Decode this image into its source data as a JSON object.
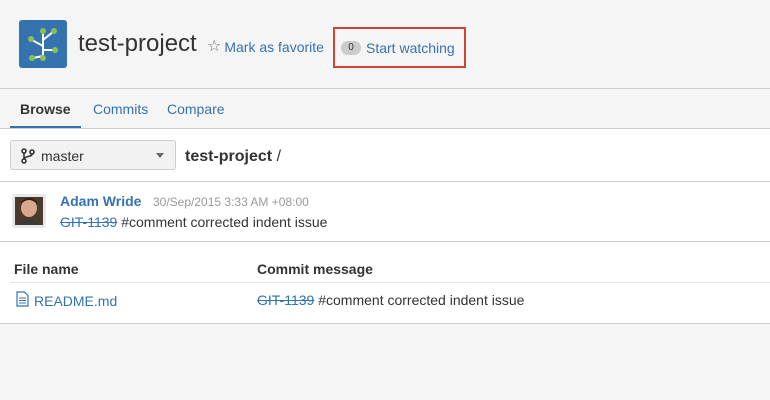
{
  "header": {
    "project_name": "test-project",
    "favorite_label": "Mark as favorite",
    "watch_count": "0",
    "watch_label": "Start watching"
  },
  "tabs": [
    {
      "label": "Browse",
      "active": true
    },
    {
      "label": "Commits",
      "active": false
    },
    {
      "label": "Compare",
      "active": false
    }
  ],
  "branch": {
    "selected": "master"
  },
  "breadcrumb": {
    "project": "test-project",
    "separator": "/"
  },
  "last_commit": {
    "author": "Adam Wride",
    "date": "30/Sep/2015 3:33 AM +08:00",
    "issue_key": "GIT-1139",
    "message": "#comment corrected indent issue"
  },
  "file_table": {
    "columns": [
      "File name",
      "Commit message"
    ],
    "rows": [
      {
        "file": "README.md",
        "issue_key": "GIT-1139",
        "message": "#comment corrected indent issue"
      }
    ]
  },
  "colors": {
    "accent": "#3572b0",
    "highlight_box": "#d04437",
    "background": "#f5f5f5"
  },
  "icons": [
    "project-logo-icon",
    "star-icon",
    "branch-icon",
    "chevron-down-icon",
    "file-icon"
  ]
}
